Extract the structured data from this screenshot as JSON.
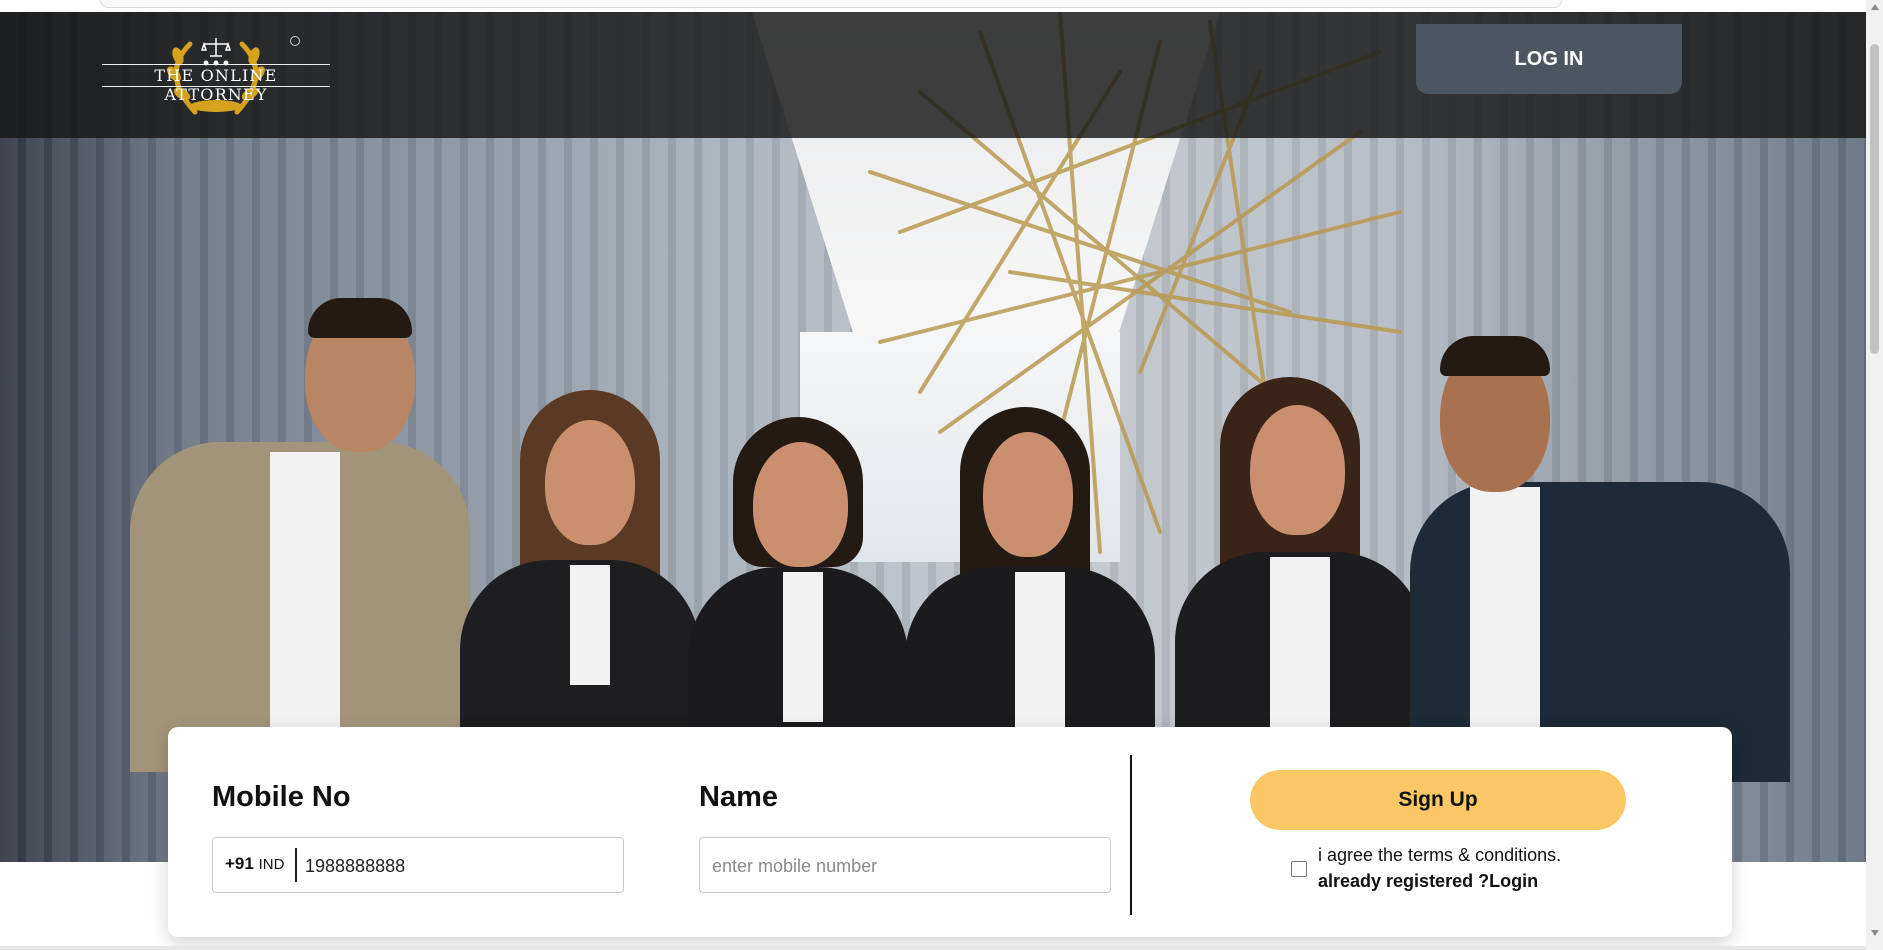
{
  "header": {
    "logo_text": "THE ONLINE ATTORNEY",
    "login_label": "LOG IN"
  },
  "form": {
    "mobile_title": "Mobile No",
    "country_code": "+91",
    "country_short": "IND",
    "mobile_value": "1988888888",
    "name_title": "Name",
    "name_placeholder": "enter mobile number",
    "signup_label": "Sign Up",
    "terms_text": "i agree the terms & conditions.",
    "login_link": "already registered ?Login"
  },
  "colors": {
    "accent": "#fcc866",
    "header_bg": "#161616",
    "login_bg": "#4d5560",
    "logo_gold": "#d4a21f"
  },
  "icons": [
    "laurel-logo-icon",
    "scale-icon",
    "star-icon",
    "trademark-icon",
    "scroll-up-icon",
    "scroll-down-icon"
  ]
}
